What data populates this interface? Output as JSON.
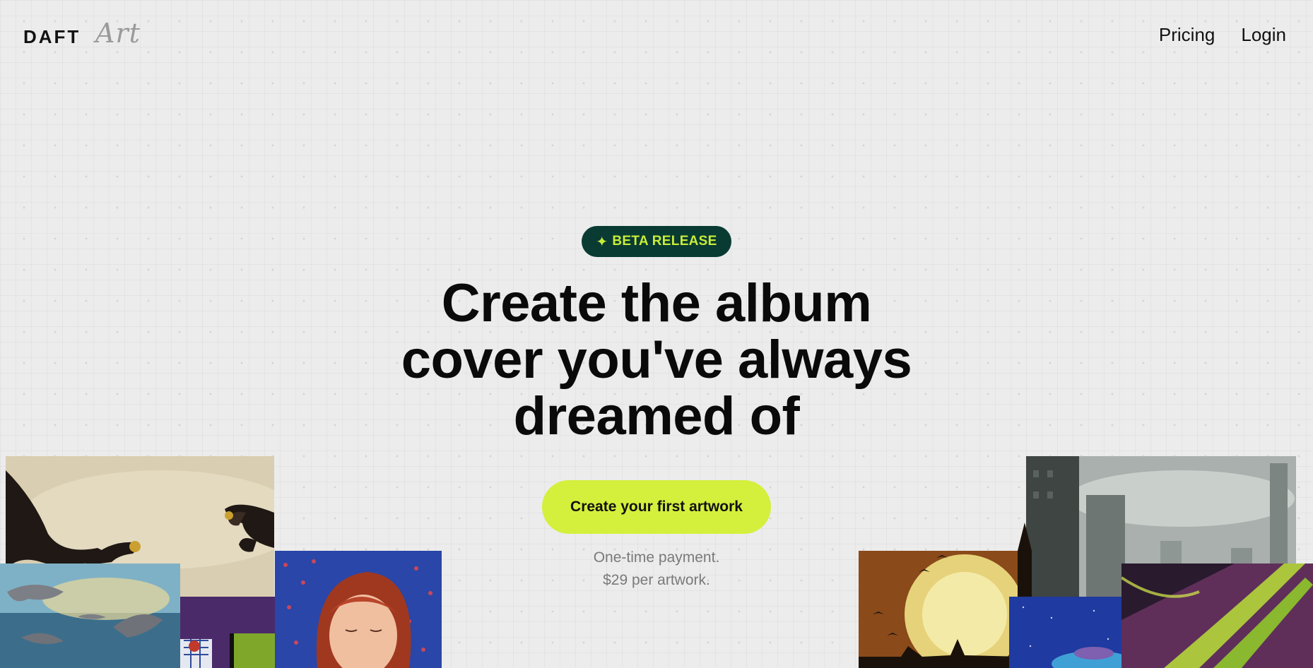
{
  "brand": {
    "word": "DAFT",
    "script": "Art"
  },
  "nav": [
    {
      "label": "Pricing"
    },
    {
      "label": "Login"
    }
  ],
  "hero": {
    "badge": "BETA RELEASE",
    "headline": "Create the album cover you've always dreamed of",
    "cta": "Create your first artwork",
    "price_line1": "One-time payment.",
    "price_line2": "$29 per artwork."
  },
  "colors": {
    "badge_bg": "#093b33",
    "badge_text": "#c8ed38",
    "cta_bg": "#d5ef3d",
    "background": "#ececec"
  },
  "icons": {
    "badge": "sparkle-icon"
  }
}
